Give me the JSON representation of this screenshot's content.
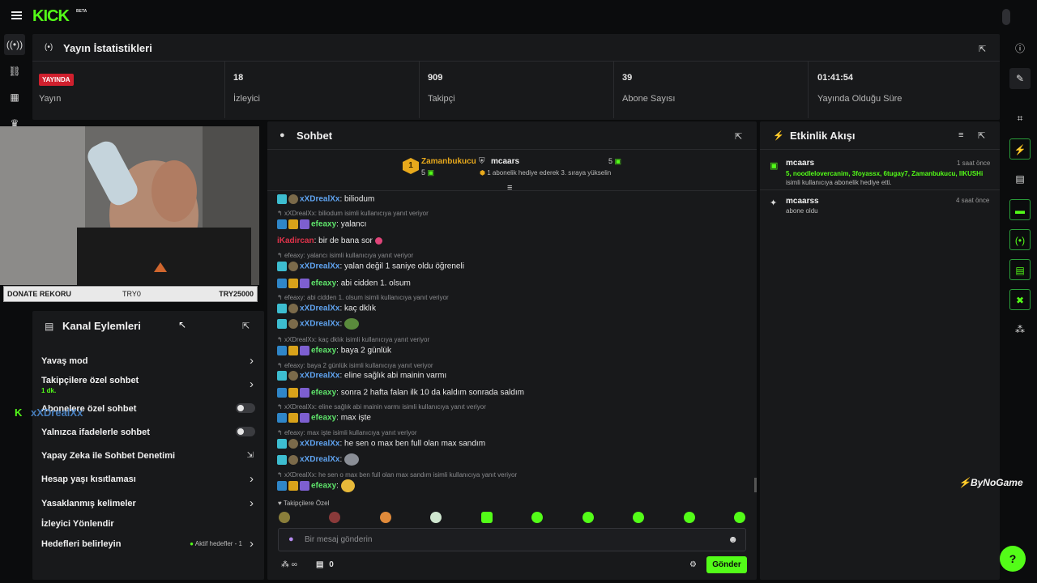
{
  "app": {
    "logo": "KICK",
    "beta": "BETA",
    "brand_color": "#53fc18"
  },
  "stats": {
    "title": "Yayın İstatistikleri",
    "live_badge": "YAYINDA",
    "live_label": "Yayın",
    "viewers_value": "18",
    "viewers_label": "İzleyici",
    "followers_value": "909",
    "followers_label": "Takipçi",
    "subs_value": "39",
    "subs_label": "Abone Sayısı",
    "uptime_value": "01:41:54",
    "uptime_label": "Yayında Olduğu Süre"
  },
  "donate": {
    "label": "DONATE REKORU",
    "min": "TRY0",
    "max": "TRY25000"
  },
  "overlay": {
    "user": "xXDrealXx"
  },
  "channel_actions": {
    "title": "Kanal Eylemleri",
    "items": [
      {
        "label": "Yavaş mod"
      },
      {
        "label": "Takipçilere özel sohbet",
        "sub": "1 dk."
      },
      {
        "label": "Abonelere özel sohbet"
      },
      {
        "label": "Yalnızca ifadelerle sohbet"
      },
      {
        "label": "Yapay Zeka ile Sohbet Denetimi"
      },
      {
        "label": "Hesap yaşı kısıtlaması"
      },
      {
        "label": "Yasaklanmış kelimeler"
      },
      {
        "label": "İzleyici Yönlendir"
      },
      {
        "label": "Hedefleri belirleyin",
        "status": "Aktif hedefler - 1"
      }
    ]
  },
  "chat": {
    "title": "Sohbet",
    "leader1": {
      "rank": "1",
      "name": "Zamanbukucu",
      "count": "5"
    },
    "leader2": {
      "name": "mcaars",
      "count": "5",
      "note": "1 abonelik hediye ederek 3. sıraya yükselin"
    },
    "messages": [
      {
        "user": "xXDrealXx",
        "text": ": biliodum"
      },
      {
        "reply": "xXDrealXx: biliodum isimli kullanıcıya yanıt veriyor"
      },
      {
        "user": "efeaxy",
        "text": ": yalancı"
      },
      {
        "user": "iKadircan",
        "text": ": bir de bana sor"
      },
      {
        "reply": "efeaxy: yalancı isimli kullanıcıya yanıt veriyor"
      },
      {
        "user": "xXDrealXx",
        "text": ": yalan değil 1 saniye oldu öğreneli"
      },
      {
        "user": "efeaxy",
        "text": ": abi cidden 1. olsum"
      },
      {
        "reply": "efeaxy: abi cidden 1. olsum isimli kullanıcıya yanıt veriyor"
      },
      {
        "user": "xXDrealXx",
        "text": ": kaç dklık"
      },
      {
        "user": "xXDrealXx",
        "text": ":"
      },
      {
        "reply": "xXDrealXx: kaç dklık isimli kullanıcıya yanıt veriyor"
      },
      {
        "user": "efeaxy",
        "text": ": baya 2 günlük"
      },
      {
        "reply": "efeaxy: baya 2 günlük isimli kullanıcıya yanıt veriyor"
      },
      {
        "user": "xXDrealXx",
        "text": ": eline sağlık abi mainin varmı"
      },
      {
        "user": "efeaxy",
        "text": ": sonra 2 hafta falan ilk 10 da kaldım sonrada saldım"
      },
      {
        "reply": "xXDrealXx: eline sağlık abi mainin varmı isimli kullanıcıya yanıt veriyor"
      },
      {
        "user": "efeaxy",
        "text": ": max işte"
      },
      {
        "reply": "efeaxy: max işte isimli kullanıcıya yanıt veriyor"
      },
      {
        "user": "xXDrealXx",
        "text": ": he sen o max ben full olan max sandım"
      },
      {
        "user": "xXDrealXx",
        "text": ":"
      },
      {
        "reply": "xXDrealXx: he sen o max ben full olan max sandım isimli kullanıcıya yanıt veriyor"
      },
      {
        "user": "efeaxy",
        "text": ":"
      }
    ],
    "emote_label": "Takipçilere Özel",
    "input_placeholder": "Bir mesaj gönderin",
    "infinity": "∞",
    "count": "0",
    "send": "Gönder"
  },
  "activity": {
    "title": "Etkinlik Akışı",
    "events": [
      {
        "user": "mcaars",
        "time": "1 saat önce",
        "highlight": "5, noodlelovercanim, 3foyassx, 6tugay7, Zamanbukucu, IIKUSHi",
        "text": "isimli kullanıcıya abonelik hediye etti."
      },
      {
        "user": "mcaarss",
        "time": "4 saat önce",
        "text": "abone oldu"
      }
    ]
  },
  "watermark": "ByNoGame"
}
